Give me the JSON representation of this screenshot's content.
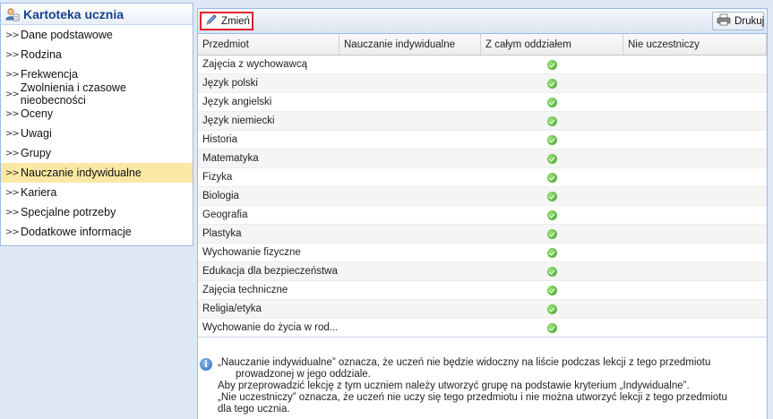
{
  "sidebar": {
    "title": "Kartoteka ucznia",
    "items": [
      {
        "label": "Dane podstawowe",
        "active": false
      },
      {
        "label": "Rodzina",
        "active": false
      },
      {
        "label": "Frekwencja",
        "active": false
      },
      {
        "label": "Zwolnienia i czasowe nieobecności",
        "active": false
      },
      {
        "label": "Oceny",
        "active": false
      },
      {
        "label": "Uwagi",
        "active": false
      },
      {
        "label": "Grupy",
        "active": false
      },
      {
        "label": "Nauczanie indywidualne",
        "active": true
      },
      {
        "label": "Kariera",
        "active": false
      },
      {
        "label": "Specjalne potrzeby",
        "active": false
      },
      {
        "label": "Dodatkowe informacje",
        "active": false
      }
    ]
  },
  "toolbar": {
    "edit_label": "Zmień",
    "print_label": "Drukuj"
  },
  "grid": {
    "columns": [
      "Przedmiot",
      "Nauczanie indywidualne",
      "Z całym oddziałem",
      "Nie uczestniczy"
    ],
    "rows": [
      {
        "subject": "Zajęcia z wychowawcą",
        "individual": false,
        "with_class": true,
        "not_participating": false
      },
      {
        "subject": "Język polski",
        "individual": false,
        "with_class": true,
        "not_participating": false
      },
      {
        "subject": "Język angielski",
        "individual": false,
        "with_class": true,
        "not_participating": false
      },
      {
        "subject": "Język niemiecki",
        "individual": false,
        "with_class": true,
        "not_participating": false
      },
      {
        "subject": "Historia",
        "individual": false,
        "with_class": true,
        "not_participating": false
      },
      {
        "subject": "Matematyka",
        "individual": false,
        "with_class": true,
        "not_participating": false
      },
      {
        "subject": "Fizyka",
        "individual": false,
        "with_class": true,
        "not_participating": false
      },
      {
        "subject": "Biologia",
        "individual": false,
        "with_class": true,
        "not_participating": false
      },
      {
        "subject": "Geografia",
        "individual": false,
        "with_class": true,
        "not_participating": false
      },
      {
        "subject": "Plastyka",
        "individual": false,
        "with_class": true,
        "not_participating": false
      },
      {
        "subject": "Wychowanie fizyczne",
        "individual": false,
        "with_class": true,
        "not_participating": false
      },
      {
        "subject": "Edukacja dla bezpieczeństwa",
        "individual": false,
        "with_class": true,
        "not_participating": false
      },
      {
        "subject": "Zajęcia techniczne",
        "individual": false,
        "with_class": true,
        "not_participating": false
      },
      {
        "subject": "Religia/etyka",
        "individual": false,
        "with_class": true,
        "not_participating": false
      },
      {
        "subject": "Wychowanie do życia w rod...",
        "individual": false,
        "with_class": true,
        "not_participating": false
      }
    ]
  },
  "info": {
    "line1": "„Nauczanie indywidualne” oznacza, że uczeń nie będzie widoczny na liście podczas lekcji z tego przedmiotu",
    "line2": "prowadzonej w jego oddziale.",
    "line3": "Aby przeprowadzić lekcję z tym uczniem należy utworzyć grupę na podstawie kryterium „Indywidualne”.",
    "line4": "„Nie uczestniczy” oznacza, że uczeń nie uczy się tego przedmiotu i nie można utworzyć lekcji z tego przedmiotu",
    "line5": "dla tego ucznia."
  },
  "colors": {
    "active_item": "#fbe8a5",
    "title_text": "#15428b",
    "panel_border": "#99bbe8",
    "highlight_border": "#e0262a",
    "check": "#3b9f1d"
  },
  "icons": {
    "sidebar_title": "student-card-icon",
    "nav_bullet": "double-chevron-right-icon",
    "edit": "pencil-icon",
    "print": "printer-icon",
    "check": "green-check-icon",
    "info": "info-icon"
  }
}
